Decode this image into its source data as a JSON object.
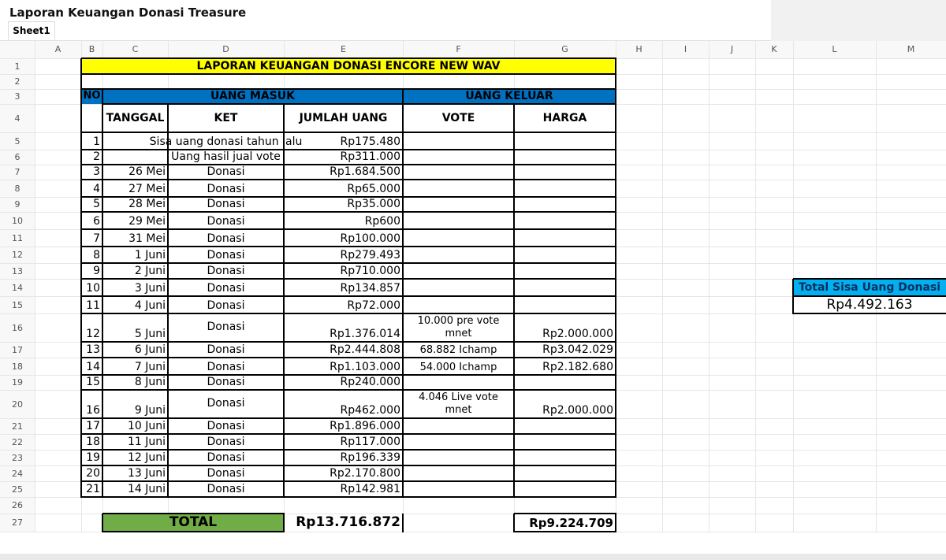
{
  "document": {
    "title": "Laporan Keuangan Donasi Treasure",
    "sheet_tab": "Sheet1"
  },
  "columns": [
    "A",
    "B",
    "C",
    "D",
    "E",
    "F",
    "G",
    "H",
    "I",
    "J",
    "K",
    "L",
    "M"
  ],
  "rows": [
    "1",
    "2",
    "3",
    "4",
    "5",
    "6",
    "7",
    "8",
    "9",
    "10",
    "11",
    "12",
    "13",
    "14",
    "15",
    "16",
    "17",
    "18",
    "19",
    "20",
    "21",
    "22",
    "23",
    "24",
    "25",
    "26",
    "27"
  ],
  "colors": {
    "title_fill": "#ffff00",
    "header_fill": "#0070c0",
    "total_fill": "#70ad47",
    "sisa_header_fill": "#00b0f0"
  },
  "report": {
    "title": "LAPORAN KEUANGAN DONASI ENCORE NEW WAV",
    "no_label": "NO",
    "uang_masuk": "UANG MASUK",
    "uang_keluar": "UANG KELUAR",
    "headers": {
      "tanggal": "TANGGAL",
      "ket": "KET",
      "jumlah": "JUMLAH UANG",
      "vote": "VOTE",
      "harga": "HARGA"
    },
    "entries": [
      {
        "no": "1",
        "tanggal": "",
        "ket": "Sisa uang donasi tahun lalu",
        "jumlah": "Rp175.480",
        "vote": "",
        "harga": ""
      },
      {
        "no": "2",
        "tanggal": "",
        "ket": "Uang hasil jual vote",
        "jumlah": "Rp311.000",
        "vote": "",
        "harga": ""
      },
      {
        "no": "3",
        "tanggal": "26 Mei",
        "ket": "Donasi",
        "jumlah": "Rp1.684.500",
        "vote": "",
        "harga": ""
      },
      {
        "no": "4",
        "tanggal": "27 Mei",
        "ket": "Donasi",
        "jumlah": "Rp65.000",
        "vote": "",
        "harga": ""
      },
      {
        "no": "5",
        "tanggal": "28 Mei",
        "ket": "Donasi",
        "jumlah": "Rp35.000",
        "vote": "",
        "harga": ""
      },
      {
        "no": "6",
        "tanggal": "29 Mei",
        "ket": "Donasi",
        "jumlah": "Rp600",
        "vote": "",
        "harga": ""
      },
      {
        "no": "7",
        "tanggal": "31 Mei",
        "ket": "Donasi",
        "jumlah": "Rp100.000",
        "vote": "",
        "harga": ""
      },
      {
        "no": "8",
        "tanggal": "1 Juni",
        "ket": "Donasi",
        "jumlah": "Rp279.493",
        "vote": "",
        "harga": ""
      },
      {
        "no": "9",
        "tanggal": "2 Juni",
        "ket": "Donasi",
        "jumlah": "Rp710.000",
        "vote": "",
        "harga": ""
      },
      {
        "no": "10",
        "tanggal": "3 Juni",
        "ket": "Donasi",
        "jumlah": "Rp134.857",
        "vote": "",
        "harga": ""
      },
      {
        "no": "11",
        "tanggal": "4 Juni",
        "ket": "Donasi",
        "jumlah": "Rp72.000",
        "vote": "",
        "harga": ""
      },
      {
        "no": "12",
        "tanggal": "5 Juni",
        "ket": "Donasi",
        "jumlah": "Rp1.376.014",
        "vote": "10.000 pre vote mnet",
        "harga": "Rp2.000.000"
      },
      {
        "no": "13",
        "tanggal": "6 Juni",
        "ket": "Donasi",
        "jumlah": "Rp2.444.808",
        "vote": "68.882 Ichamp",
        "harga": "Rp3.042.029"
      },
      {
        "no": "14",
        "tanggal": "7 Juni",
        "ket": "Donasi",
        "jumlah": "Rp1.103.000",
        "vote": "54.000 Ichamp",
        "harga": "Rp2.182.680"
      },
      {
        "no": "15",
        "tanggal": "8 Juni",
        "ket": "Donasi",
        "jumlah": "Rp240.000",
        "vote": "",
        "harga": ""
      },
      {
        "no": "16",
        "tanggal": "9 Juni",
        "ket": "Donasi",
        "jumlah": "Rp462.000",
        "vote": "4.046 Live vote mnet",
        "harga": "Rp2.000.000"
      },
      {
        "no": "17",
        "tanggal": "10 Juni",
        "ket": "Donasi",
        "jumlah": "Rp1.896.000",
        "vote": "",
        "harga": ""
      },
      {
        "no": "18",
        "tanggal": "11 Juni",
        "ket": "Donasi",
        "jumlah": "Rp117.000",
        "vote": "",
        "harga": ""
      },
      {
        "no": "19",
        "tanggal": "12 Juni",
        "ket": "Donasi",
        "jumlah": "Rp196.339",
        "vote": "",
        "harga": ""
      },
      {
        "no": "20",
        "tanggal": "13 Juni",
        "ket": "Donasi",
        "jumlah": "Rp2.170.800",
        "vote": "",
        "harga": ""
      },
      {
        "no": "21",
        "tanggal": "14 Juni",
        "ket": "Donasi",
        "jumlah": "Rp142.981",
        "vote": "",
        "harga": ""
      }
    ],
    "total_label": "TOTAL",
    "total_masuk": "Rp13.716.872",
    "total_keluar": "Rp9.224.709"
  },
  "sisa": {
    "label": "Total Sisa Uang Donasi",
    "value": "Rp4.492.163"
  }
}
